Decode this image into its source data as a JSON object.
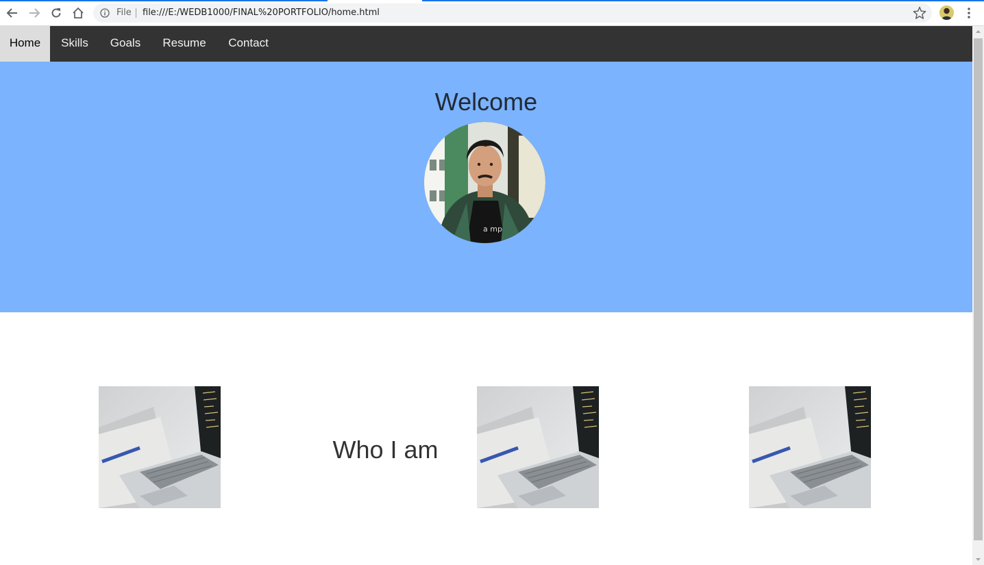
{
  "browser": {
    "back_icon": "arrow-left-icon",
    "forward_icon": "arrow-right-icon",
    "reload_icon": "reload-icon",
    "home_icon": "home-icon",
    "info_icon": "info-icon",
    "file_label": "File",
    "url": "file:///E:/WEDB1000/FINAL%20PORTFOLIO/home.html",
    "bookmark_icon": "star-icon",
    "profile_icon": "profile-avatar",
    "menu_icon": "three-dots-menu-icon",
    "accent_color": "#1a73e8"
  },
  "nav": {
    "items": [
      {
        "label": "Home",
        "active": true
      },
      {
        "label": "Skills",
        "active": false
      },
      {
        "label": "Goals",
        "active": false
      },
      {
        "label": "Resume",
        "active": false
      },
      {
        "label": "Contact",
        "active": false
      }
    ],
    "background": "#333333",
    "active_background": "#dddddd"
  },
  "hero": {
    "title": "Welcome",
    "background": "#7bb3ff",
    "photo": "portrait-photo"
  },
  "content": {
    "heading": "Who I am",
    "images": [
      "laptop-photo",
      "laptop-photo",
      "laptop-photo"
    ]
  }
}
